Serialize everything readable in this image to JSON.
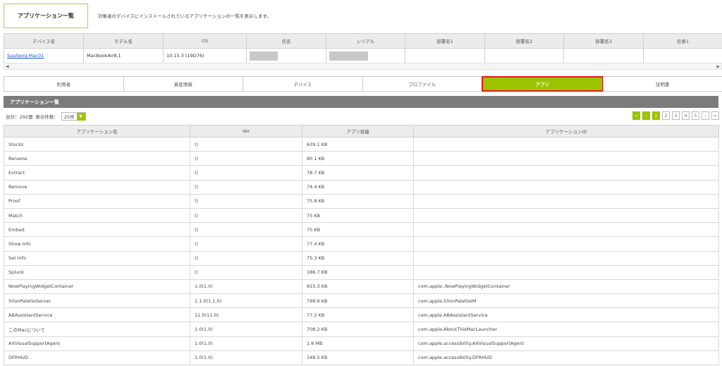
{
  "page": {
    "title": "アプリケーション一覧",
    "description": "対象者のデバイスにインストールされているアプリケーションの一覧を表示します。"
  },
  "device_table": {
    "headers": [
      "デバイス名",
      "モデル名",
      "OS",
      "氏名",
      "シリアル",
      "部署名1",
      "部署名2",
      "部署名3",
      "任意1"
    ],
    "row": {
      "device_name": "SaaSeng-Mac01",
      "model": "MacBookAir8,1",
      "os": "10.15.3 (19D76)"
    }
  },
  "scroll": {
    "left": "◀",
    "right": "▶"
  },
  "tabs": [
    {
      "label": "利用者",
      "active": false
    },
    {
      "label": "資産情報",
      "active": false
    },
    {
      "label": "デバイス",
      "active": false
    },
    {
      "label": "プロファイル",
      "active": false
    },
    {
      "label": "アプリ",
      "active": true
    },
    {
      "label": "証明書",
      "active": false
    }
  ],
  "section": {
    "title": "アプリケーション一覧"
  },
  "meta": {
    "total": "合計：292個",
    "per_page_label": "表示件数：",
    "per_page_value": "25件",
    "dropdown_icon": "▼"
  },
  "pager": {
    "first": "«",
    "prev": "‹",
    "pages": [
      "1",
      "2",
      "3",
      "4",
      "5"
    ],
    "next": "›",
    "last": "»",
    "current": "1"
  },
  "app_table": {
    "headers": [
      "アプリケーション名",
      "Ver",
      "アプリ容量",
      "アプリケーションID"
    ],
    "rows": [
      [
        "Stocks",
        "()",
        "639.1 KB",
        ""
      ],
      [
        "Rename",
        "()",
        "80.1 KB",
        ""
      ],
      [
        "Extract",
        "()",
        "78.7 KB",
        ""
      ],
      [
        "Remove",
        "()",
        "74.4 KB",
        ""
      ],
      [
        "Proof",
        "()",
        "75.8 KB",
        ""
      ],
      [
        "Match",
        "()",
        "75 KB",
        ""
      ],
      [
        "Embed",
        "()",
        "75 KB",
        ""
      ],
      [
        "Show Info",
        "()",
        "77.4 KB",
        ""
      ],
      [
        "Set Info",
        "()",
        "75.3 KB",
        ""
      ],
      [
        "Splunk",
        "()",
        "186.7 KB",
        ""
      ],
      [
        "NowPlayingWidgetContainer",
        "1.0(1.0)",
        "815.3 KB",
        "com.apple..NowPlayingWidgetContainer"
      ],
      [
        "50onPaletteServer",
        "1.1.0(1.1.0)",
        "799.6 KB",
        "com.apple.50onPaletteIM"
      ],
      [
        "ABAssistantService",
        "11.0(11.0)",
        "77.2 KB",
        "com.apple.ABAssistantService"
      ],
      [
        "このMacについて",
        "1.0(1.0)",
        "708.2 KB",
        "com.apple.AboutThisMacLauncher"
      ],
      [
        "AXVisualSupportAgent",
        "1.0(1.0)",
        "1.6 MB",
        "com.apple.accessibility.AXVisualSupportAgent"
      ],
      [
        "DFRHUD",
        "1.0(1.0)",
        "148.5 KB",
        "com.apple.accessibility.DFRHUD"
      ]
    ]
  }
}
